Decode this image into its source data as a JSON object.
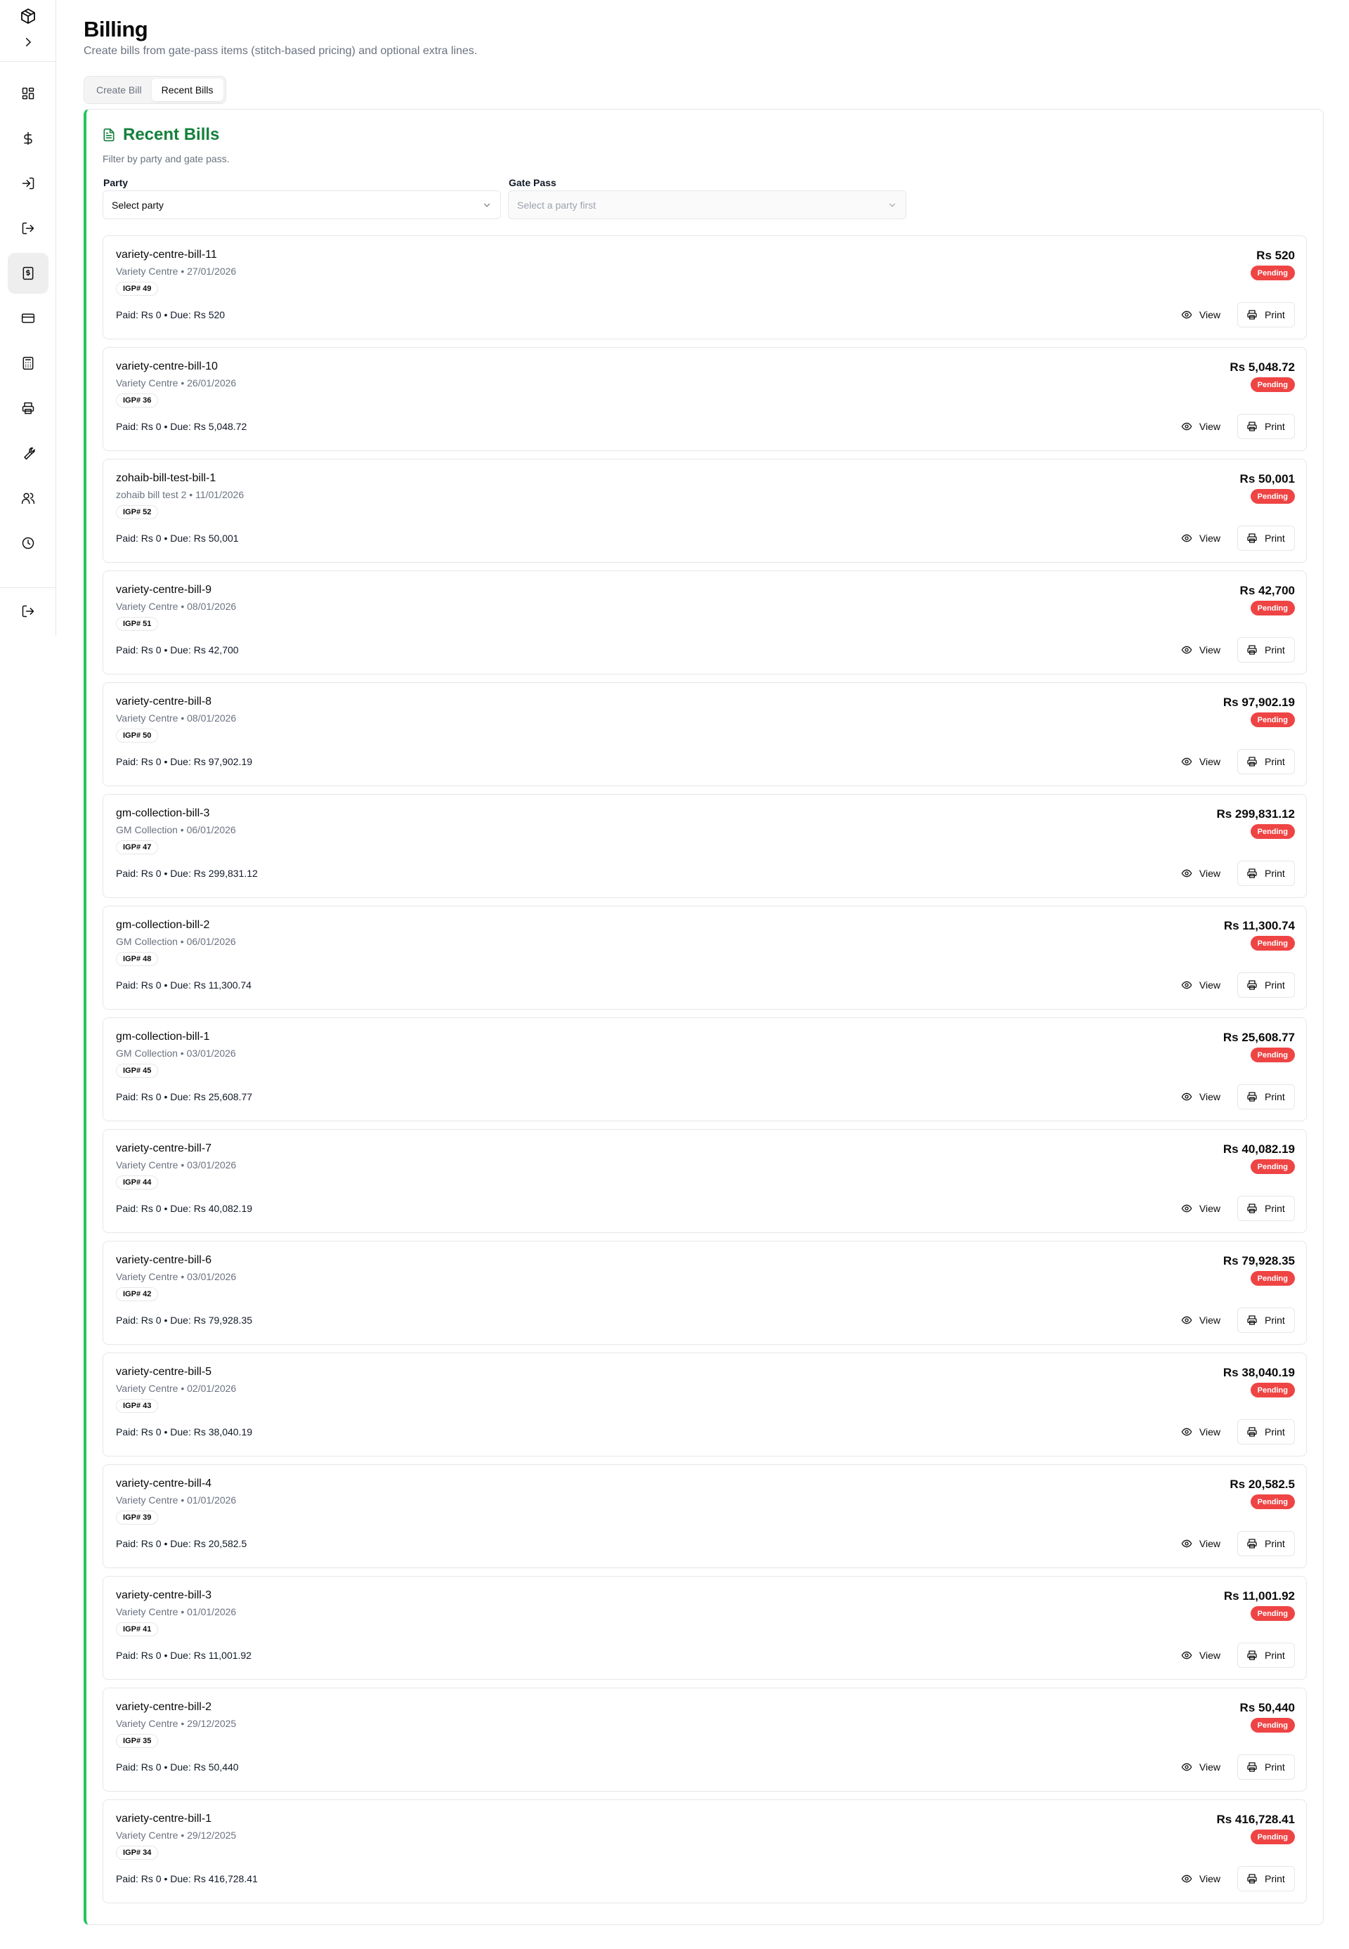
{
  "header": {
    "title": "Billing",
    "subtitle": "Create bills from gate-pass items (stitch-based pricing) and optional extra lines."
  },
  "tabs": [
    {
      "label": "Create Bill",
      "active": false
    },
    {
      "label": "Recent Bills",
      "active": true
    }
  ],
  "sidebar": {
    "items": [
      {
        "icon": "dashboard-icon",
        "active": false
      },
      {
        "icon": "dollar-icon",
        "active": false
      },
      {
        "icon": "log-in-icon",
        "active": false
      },
      {
        "icon": "log-out-icon",
        "active": false
      },
      {
        "icon": "receipt-icon",
        "active": true
      },
      {
        "icon": "credit-card-icon",
        "active": false
      },
      {
        "icon": "calculator-icon",
        "active": false
      },
      {
        "icon": "printer-icon",
        "active": false
      },
      {
        "icon": "wrench-icon",
        "active": false
      },
      {
        "icon": "users-icon",
        "active": false
      },
      {
        "icon": "clock-icon",
        "active": false
      }
    ],
    "logout_icon": "logout-icon"
  },
  "panel": {
    "title": "Recent Bills",
    "description": "Filter by party and gate pass.",
    "accent_color": "#22c55e",
    "title_color": "#15803d",
    "filters": {
      "party_label": "Party",
      "party_value": "Select party",
      "gatepass_label": "Gate Pass",
      "gatepass_value": "Select a party first"
    }
  },
  "bill_labels": {
    "view": "View",
    "print": "Print",
    "status": "Pending",
    "status_color": "#ef4444"
  },
  "bills": [
    {
      "name": "variety-centre-bill-11",
      "party": "Variety Centre",
      "date": "27/01/2026",
      "igp": "IGP# 49",
      "amount": "Rs 520",
      "payline": "Paid: Rs 0 • Due: Rs 520"
    },
    {
      "name": "variety-centre-bill-10",
      "party": "Variety Centre",
      "date": "26/01/2026",
      "igp": "IGP# 36",
      "amount": "Rs 5,048.72",
      "payline": "Paid: Rs 0 • Due: Rs 5,048.72"
    },
    {
      "name": "zohaib-bill-test-bill-1",
      "party": "zohaib bill test 2",
      "date": "11/01/2026",
      "igp": "IGP# 52",
      "amount": "Rs 50,001",
      "payline": "Paid: Rs 0 • Due: Rs 50,001"
    },
    {
      "name": "variety-centre-bill-9",
      "party": "Variety Centre",
      "date": "08/01/2026",
      "igp": "IGP# 51",
      "amount": "Rs 42,700",
      "payline": "Paid: Rs 0 • Due: Rs 42,700"
    },
    {
      "name": "variety-centre-bill-8",
      "party": "Variety Centre",
      "date": "08/01/2026",
      "igp": "IGP# 50",
      "amount": "Rs 97,902.19",
      "payline": "Paid: Rs 0 • Due: Rs 97,902.19"
    },
    {
      "name": "gm-collection-bill-3",
      "party": "GM Collection",
      "date": "06/01/2026",
      "igp": "IGP# 47",
      "amount": "Rs 299,831.12",
      "payline": "Paid: Rs 0 • Due: Rs 299,831.12"
    },
    {
      "name": "gm-collection-bill-2",
      "party": "GM Collection",
      "date": "06/01/2026",
      "igp": "IGP# 48",
      "amount": "Rs 11,300.74",
      "payline": "Paid: Rs 0 • Due: Rs 11,300.74"
    },
    {
      "name": "gm-collection-bill-1",
      "party": "GM Collection",
      "date": "03/01/2026",
      "igp": "IGP# 45",
      "amount": "Rs 25,608.77",
      "payline": "Paid: Rs 0 • Due: Rs 25,608.77"
    },
    {
      "name": "variety-centre-bill-7",
      "party": "Variety Centre",
      "date": "03/01/2026",
      "igp": "IGP# 44",
      "amount": "Rs 40,082.19",
      "payline": "Paid: Rs 0 • Due: Rs 40,082.19"
    },
    {
      "name": "variety-centre-bill-6",
      "party": "Variety Centre",
      "date": "03/01/2026",
      "igp": "IGP# 42",
      "amount": "Rs 79,928.35",
      "payline": "Paid: Rs 0 • Due: Rs 79,928.35"
    },
    {
      "name": "variety-centre-bill-5",
      "party": "Variety Centre",
      "date": "02/01/2026",
      "igp": "IGP# 43",
      "amount": "Rs 38,040.19",
      "payline": "Paid: Rs 0 • Due: Rs 38,040.19"
    },
    {
      "name": "variety-centre-bill-4",
      "party": "Variety Centre",
      "date": "01/01/2026",
      "igp": "IGP# 39",
      "amount": "Rs 20,582.5",
      "payline": "Paid: Rs 0 • Due: Rs 20,582.5"
    },
    {
      "name": "variety-centre-bill-3",
      "party": "Variety Centre",
      "date": "01/01/2026",
      "igp": "IGP# 41",
      "amount": "Rs 11,001.92",
      "payline": "Paid: Rs 0 • Due: Rs 11,001.92"
    },
    {
      "name": "variety-centre-bill-2",
      "party": "Variety Centre",
      "date": "29/12/2025",
      "igp": "IGP# 35",
      "amount": "Rs 50,440",
      "payline": "Paid: Rs 0 • Due: Rs 50,440"
    },
    {
      "name": "variety-centre-bill-1",
      "party": "Variety Centre",
      "date": "29/12/2025",
      "igp": "IGP# 34",
      "amount": "Rs 416,728.41",
      "payline": "Paid: Rs 0 • Due: Rs 416,728.41"
    }
  ]
}
